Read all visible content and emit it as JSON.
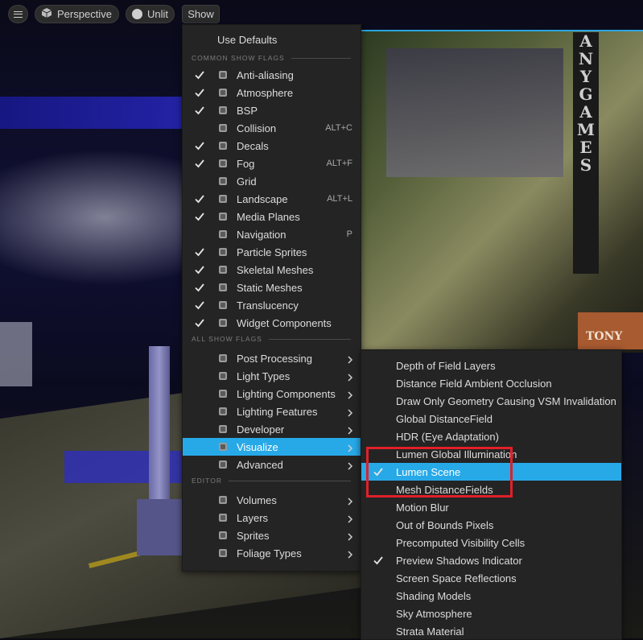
{
  "toolbar": {
    "menu_icon": "hamburger-icon",
    "perspective_label": "Perspective",
    "perspective_icon": "cube-icon",
    "unlit_label": "Unlit",
    "unlit_icon": "sphere-icon",
    "show_label": "Show"
  },
  "scene": {
    "sign_text": "ANY GAMES",
    "tony_text": "TONY"
  },
  "show_menu": {
    "use_defaults": "Use Defaults",
    "section_common": "COMMON SHOW FLAGS",
    "section_all": "ALL SHOW FLAGS",
    "section_editor": "EDITOR",
    "common_items": [
      {
        "label": "Anti-aliasing",
        "checked": true,
        "icon": "anti-aliasing-icon",
        "shortcut": ""
      },
      {
        "label": "Atmosphere",
        "checked": true,
        "icon": "atmosphere-icon",
        "shortcut": ""
      },
      {
        "label": "BSP",
        "checked": true,
        "icon": "bsp-icon",
        "shortcut": ""
      },
      {
        "label": "Collision",
        "checked": false,
        "icon": "collision-icon",
        "shortcut": "ALT+C"
      },
      {
        "label": "Decals",
        "checked": true,
        "icon": "decals-icon",
        "shortcut": ""
      },
      {
        "label": "Fog",
        "checked": true,
        "icon": "fog-icon",
        "shortcut": "ALT+F"
      },
      {
        "label": "Grid",
        "checked": false,
        "icon": "grid-icon",
        "shortcut": ""
      },
      {
        "label": "Landscape",
        "checked": true,
        "icon": "landscape-icon",
        "shortcut": "ALT+L"
      },
      {
        "label": "Media Planes",
        "checked": true,
        "icon": "media-planes-icon",
        "shortcut": ""
      },
      {
        "label": "Navigation",
        "checked": false,
        "icon": "navigation-icon",
        "shortcut": "P"
      },
      {
        "label": "Particle Sprites",
        "checked": true,
        "icon": "particle-sprites-icon",
        "shortcut": ""
      },
      {
        "label": "Skeletal Meshes",
        "checked": true,
        "icon": "skeletal-meshes-icon",
        "shortcut": ""
      },
      {
        "label": "Static Meshes",
        "checked": true,
        "icon": "static-meshes-icon",
        "shortcut": ""
      },
      {
        "label": "Translucency",
        "checked": true,
        "icon": "translucency-icon",
        "shortcut": ""
      },
      {
        "label": "Widget Components",
        "checked": true,
        "icon": "widget-components-icon",
        "shortcut": ""
      }
    ],
    "all_items": [
      {
        "label": "Post Processing",
        "icon": "post-processing-icon",
        "highlighted": false
      },
      {
        "label": "Light Types",
        "icon": "light-types-icon",
        "highlighted": false
      },
      {
        "label": "Lighting Components",
        "icon": "lighting-components-icon",
        "highlighted": false
      },
      {
        "label": "Lighting Features",
        "icon": "lighting-features-icon",
        "highlighted": false
      },
      {
        "label": "Developer",
        "icon": "developer-icon",
        "highlighted": false
      },
      {
        "label": "Visualize",
        "icon": "visualize-icon",
        "highlighted": true
      },
      {
        "label": "Advanced",
        "icon": "advanced-icon",
        "highlighted": false
      }
    ],
    "editor_items": [
      {
        "label": "Volumes",
        "icon": "volumes-icon"
      },
      {
        "label": "Layers",
        "icon": "layers-icon"
      },
      {
        "label": "Sprites",
        "icon": "sprites-icon"
      },
      {
        "label": "Foliage Types",
        "icon": "foliage-types-icon"
      }
    ]
  },
  "visualize_menu": {
    "items": [
      {
        "label": "Depth of Field Layers",
        "checked": false,
        "highlighted": false
      },
      {
        "label": "Distance Field Ambient Occlusion",
        "checked": false,
        "highlighted": false
      },
      {
        "label": "Draw Only Geometry Causing VSM Invalidation",
        "checked": false,
        "highlighted": false
      },
      {
        "label": "Global DistanceField",
        "checked": false,
        "highlighted": false
      },
      {
        "label": "HDR (Eye Adaptation)",
        "checked": false,
        "highlighted": false
      },
      {
        "label": "Lumen Global Illumination",
        "checked": false,
        "highlighted": false
      },
      {
        "label": "Lumen Scene",
        "checked": true,
        "highlighted": true
      },
      {
        "label": "Mesh DistanceFields",
        "checked": false,
        "highlighted": false
      },
      {
        "label": "Motion Blur",
        "checked": false,
        "highlighted": false
      },
      {
        "label": "Out of Bounds Pixels",
        "checked": false,
        "highlighted": false
      },
      {
        "label": "Precomputed Visibility Cells",
        "checked": false,
        "highlighted": false
      },
      {
        "label": "Preview Shadows Indicator",
        "checked": true,
        "highlighted": false
      },
      {
        "label": "Screen Space Reflections",
        "checked": false,
        "highlighted": false
      },
      {
        "label": "Shading Models",
        "checked": false,
        "highlighted": false
      },
      {
        "label": "Sky Atmosphere",
        "checked": false,
        "highlighted": false
      },
      {
        "label": "Strata Material",
        "checked": false,
        "highlighted": false
      }
    ]
  },
  "colors": {
    "highlight": "#27a9e8",
    "annotation_box": "#e0202a",
    "menu_bg": "#242424"
  }
}
